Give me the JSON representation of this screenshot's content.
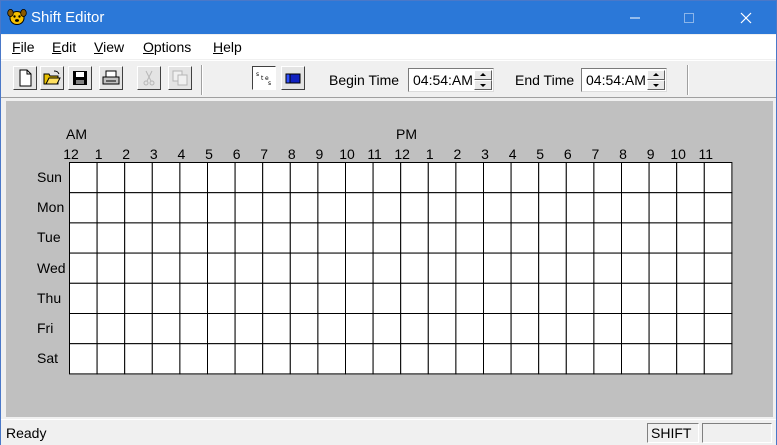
{
  "window": {
    "title": "Shift Editor",
    "icon": "dog-face-icon"
  },
  "menu": [
    {
      "label": "File",
      "mnemonic": "F"
    },
    {
      "label": "Edit",
      "mnemonic": "E"
    },
    {
      "label": "View",
      "mnemonic": "V"
    },
    {
      "label": "Options",
      "mnemonic": "O"
    },
    {
      "label": "Help",
      "mnemonic": "H"
    }
  ],
  "toolbar": {
    "buttons": [
      "new-document-icon",
      "open-folder-icon",
      "save-disk-icon",
      "print-icon",
      "cut-scissors-icon",
      "copy-icon",
      "step-mode-icon",
      "block-mode-icon"
    ],
    "begin_label": "Begin Time",
    "begin_value": "04:54:AM",
    "end_label": "End Time",
    "end_value": "04:54:AM"
  },
  "schedule": {
    "am_label": "AM",
    "pm_label": "PM",
    "hours": [
      "12",
      "1",
      "2",
      "3",
      "4",
      "5",
      "6",
      "7",
      "8",
      "9",
      "10",
      "11",
      "12",
      "1",
      "2",
      "3",
      "4",
      "5",
      "6",
      "7",
      "8",
      "9",
      "10",
      "11"
    ],
    "days": [
      "Sun",
      "Mon",
      "Tue",
      "Wed",
      "Thu",
      "Fri",
      "Sat"
    ]
  },
  "status": {
    "text": "Ready",
    "mode": "SHIFT",
    "extra": ""
  }
}
